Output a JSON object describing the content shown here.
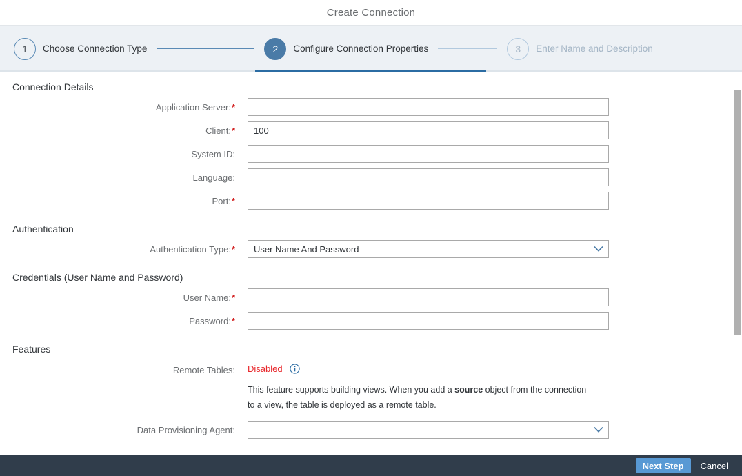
{
  "window": {
    "title": "Create Connection"
  },
  "wizard": {
    "steps": [
      {
        "number": "1",
        "label": "Choose Connection Type",
        "state": "done"
      },
      {
        "number": "2",
        "label": "Configure Connection Properties",
        "state": "active"
      },
      {
        "number": "3",
        "label": "Enter Name and Description",
        "state": "upcoming"
      }
    ]
  },
  "sections": {
    "connection_details": {
      "title": "Connection Details",
      "fields": [
        {
          "label": "Application Server:",
          "required": true,
          "value": "",
          "type": "text"
        },
        {
          "label": "Client:",
          "required": true,
          "value": "100",
          "type": "text"
        },
        {
          "label": "System ID:",
          "required": false,
          "value": "",
          "type": "text"
        },
        {
          "label": "Language:",
          "required": false,
          "value": "",
          "type": "text"
        },
        {
          "label": "Port:",
          "required": true,
          "value": "",
          "type": "text"
        }
      ]
    },
    "authentication": {
      "title": "Authentication",
      "type_label": "Authentication Type:",
      "type_required": true,
      "type_value": "User Name And Password"
    },
    "credentials": {
      "title": "Credentials (User Name and Password)",
      "fields": [
        {
          "label": "User Name:",
          "required": true,
          "value": "",
          "type": "text"
        },
        {
          "label": "Password:",
          "required": true,
          "value": "",
          "type": "password"
        }
      ]
    },
    "features": {
      "title": "Features",
      "remote_tables_label": "Remote Tables:",
      "remote_tables_status": "Disabled",
      "help_prefix": "This feature supports building views. When you add a ",
      "help_bold": "source",
      "help_suffix": " object from the connection to a view, the table is deployed as a remote table.",
      "agent_label": "Data Provisioning Agent:",
      "agent_value": ""
    }
  },
  "footer": {
    "next_label": "Next Step",
    "cancel_label": "Cancel"
  },
  "colors": {
    "accent_blue": "#4a7ba7",
    "active_underline": "#2b6ca3",
    "wizard_bg": "#edf1f5",
    "footer_bg": "#303d4b",
    "primary_button": "#5899d4",
    "required_red": "#d32424",
    "status_red": "#e8262a"
  }
}
